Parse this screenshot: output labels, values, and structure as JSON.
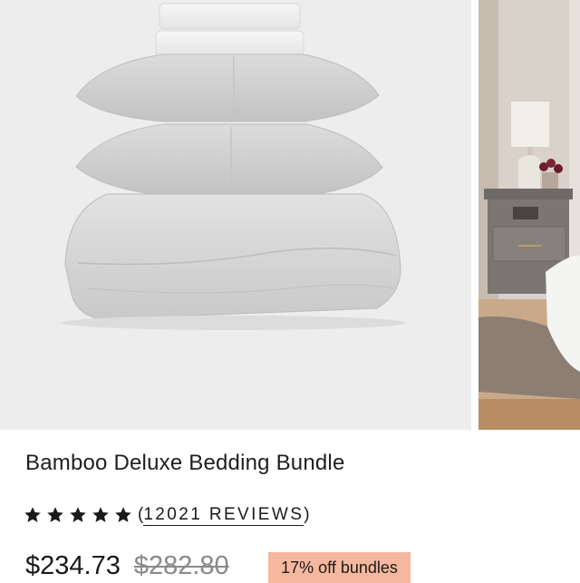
{
  "product": {
    "title": "Bamboo Deluxe Bedding Bundle",
    "rating": 5,
    "rating_max": 5,
    "reviews_open": "(",
    "reviews_label": "12021 REVIEWS",
    "reviews_close": ")",
    "price": "$234.73",
    "original_price": "$282.80",
    "discount_badge": "17% off bundles"
  },
  "colors": {
    "badge_bg": "#f5b89e",
    "text": "#1a1a1a",
    "strike_text": "#8a8a8a",
    "photo_bg": "#ededed"
  },
  "icons": {
    "star": "star-icon"
  }
}
